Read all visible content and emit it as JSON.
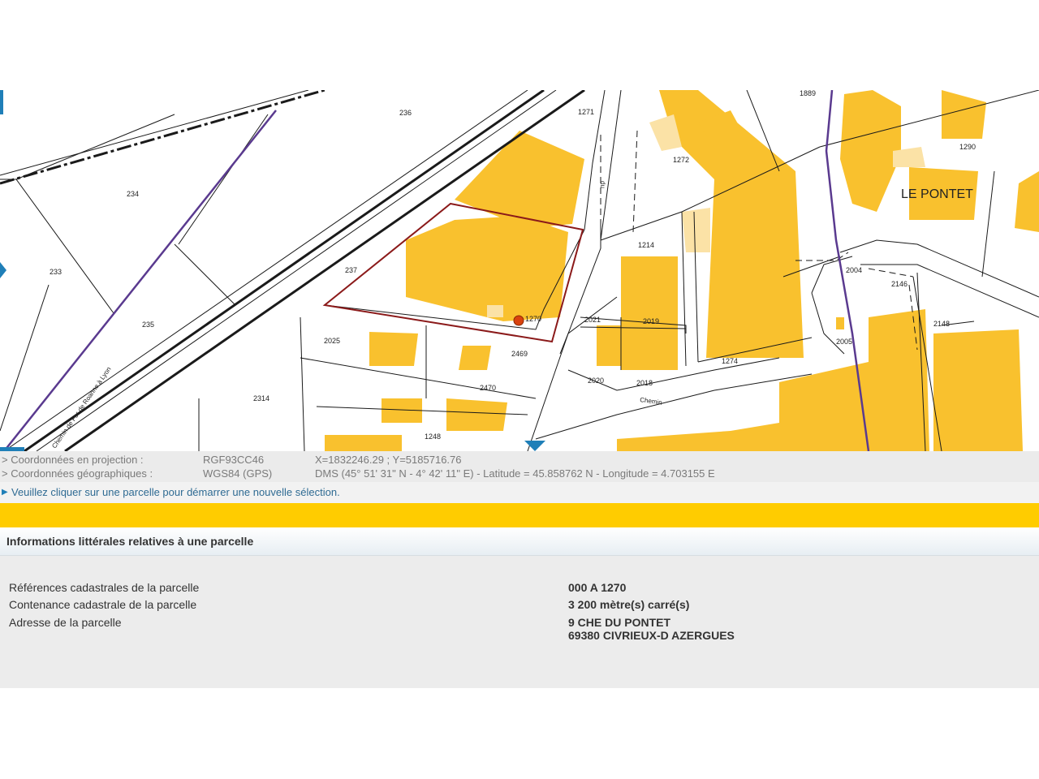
{
  "map": {
    "parcel_numbers": [
      {
        "id": "236",
        "label": "236"
      },
      {
        "id": "1271",
        "label": "1271"
      },
      {
        "id": "1889",
        "label": "1889"
      },
      {
        "id": "1290",
        "label": "1290"
      },
      {
        "id": "1272",
        "label": "1272"
      },
      {
        "id": "234",
        "label": "234"
      },
      {
        "id": "233",
        "label": "233"
      },
      {
        "id": "235",
        "label": "235"
      },
      {
        "id": "237",
        "label": "237"
      },
      {
        "id": "1270",
        "label": "1270"
      },
      {
        "id": "1214",
        "label": "1214"
      },
      {
        "id": "2004",
        "label": "2004"
      },
      {
        "id": "2146",
        "label": "2146"
      },
      {
        "id": "2148",
        "label": "2148"
      },
      {
        "id": "2021",
        "label": "2021"
      },
      {
        "id": "2019",
        "label": "2019"
      },
      {
        "id": "2025",
        "label": "2025"
      },
      {
        "id": "2469",
        "label": "2469"
      },
      {
        "id": "2470",
        "label": "2470"
      },
      {
        "id": "1274",
        "label": "1274"
      },
      {
        "id": "2005",
        "label": "2005"
      },
      {
        "id": "2020",
        "label": "2020"
      },
      {
        "id": "2018",
        "label": "2018"
      },
      {
        "id": "2314",
        "label": "2314"
      },
      {
        "id": "1248",
        "label": "1248"
      }
    ],
    "place_name": "LE PONTET",
    "road_labels": {
      "chemin": "Chemin",
      "du": "du",
      "railway": "Chemin de Fer de Roanne à Lyon"
    },
    "colors": {
      "building": "#f9c12e",
      "building_light": "#fbe2a6",
      "selected_parcel": "#8b1a1a",
      "commune_boundary": "#5a3a8f",
      "marker": "#d9420e",
      "nav_arrow": "#1f7fb8"
    },
    "marker_icon": "location-dot-icon"
  },
  "coordinates": {
    "projection": {
      "label": "> Coordonnées en projection :",
      "system": "RGF93CC46",
      "value": "X=1832246.29 ; Y=5185716.76"
    },
    "geographic": {
      "label": "> Coordonnées géographiques :",
      "system": "WGS84 (GPS)",
      "value": "DMS (45° 51' 31\" N - 4° 42' 11\" E) - Latitude = 45.858762 N - Longitude = 4.703155 E"
    }
  },
  "hint": {
    "icon": "triangle-right-icon",
    "text": "Veuillez cliquer sur une parcelle pour démarrer une nouvelle sélection."
  },
  "info": {
    "title": "Informations littérales relatives à une parcelle",
    "rows": [
      {
        "label": "Références cadastrales de la parcelle",
        "value": "000 A 1270",
        "value2": ""
      },
      {
        "label": "Contenance cadastrale de la parcelle",
        "value": "3 200 mètre(s) carré(s)",
        "value2": ""
      },
      {
        "label": "Adresse de la parcelle",
        "value": "9 CHE DU PONTET",
        "value2": "69380 CIVRIEUX-D AZERGUES"
      }
    ]
  }
}
